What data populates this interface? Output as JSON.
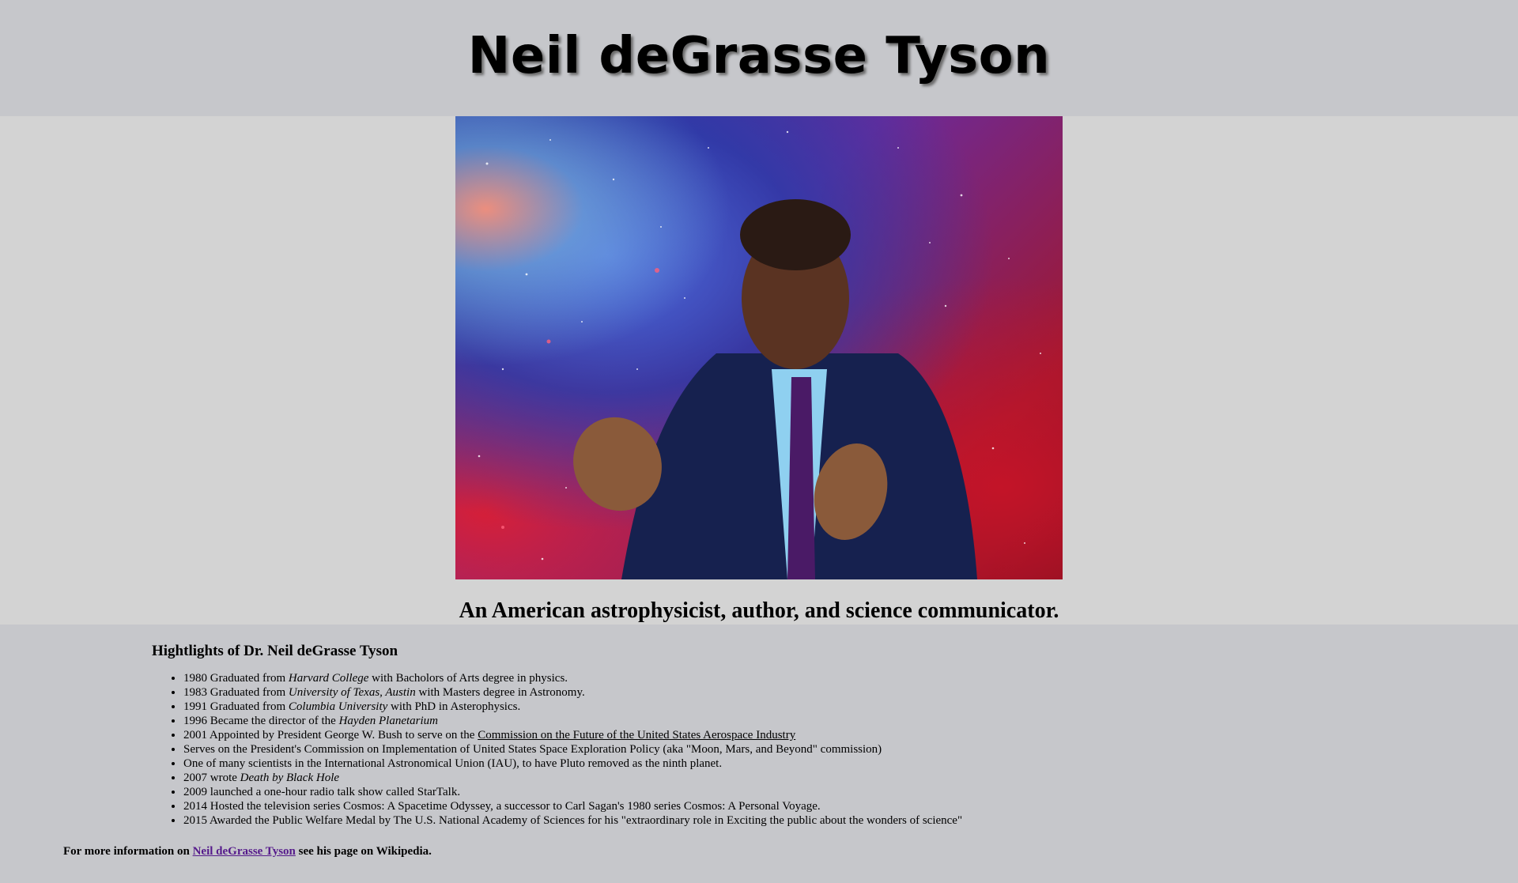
{
  "header": {
    "title": "Neil deGrasse Tyson"
  },
  "hero": {
    "image_alt": "Portrait of Neil deGrasse Tyson against a galaxy background",
    "subtitle": "An American astrophysicist, author, and science communicator."
  },
  "highlights": {
    "title": "Hightlights of Dr. Neil deGrasse Tyson",
    "items": [
      {
        "pre": "1980 Graduated from ",
        "em": "Harvard College",
        "post": " with Bacholors of Arts degree in physics."
      },
      {
        "pre": "1983 Graduated from ",
        "em": "University of Texas, Austin",
        "post": " with Masters degree in Astronomy."
      },
      {
        "pre": "1991 Graduated from ",
        "em": "Columbia University",
        "post": " with PhD in Asterophysics."
      },
      {
        "pre": "1996 Became the director of the ",
        "em": "Hayden Planetarium",
        "post": ""
      },
      {
        "pre": "2001 Appointed by President George W. Bush to serve on the ",
        "u": "Commission on the Future of the United States Aerospace Industry",
        "post": ""
      },
      {
        "pre": "Serves on the President's Commission on Implementation of United States Space Exploration Policy (aka \"Moon, Mars, and Beyond\" commission)"
      },
      {
        "pre": "One of many scientists in the International Astronomical Union (IAU), to have Pluto removed as the ninth planet."
      },
      {
        "pre": "2007 wrote ",
        "em": "Death by Black Hole",
        "post": ""
      },
      {
        "pre": "2009 launched a one-hour radio talk show called StarTalk."
      },
      {
        "pre": "2014 Hosted the television series Cosmos: A Spacetime Odyssey, a successor to Carl Sagan's 1980 series Cosmos: A Personal Voyage."
      },
      {
        "pre": "2015 Awarded the Public Welfare Medal by The U.S. National Academy of Sciences for his \"extraordinary role in Exciting the public about the wonders of science\""
      }
    ]
  },
  "footer": {
    "before": "For more information on ",
    "link": "Neil deGrasse Tyson",
    "after": " see his page on Wikipedia."
  }
}
